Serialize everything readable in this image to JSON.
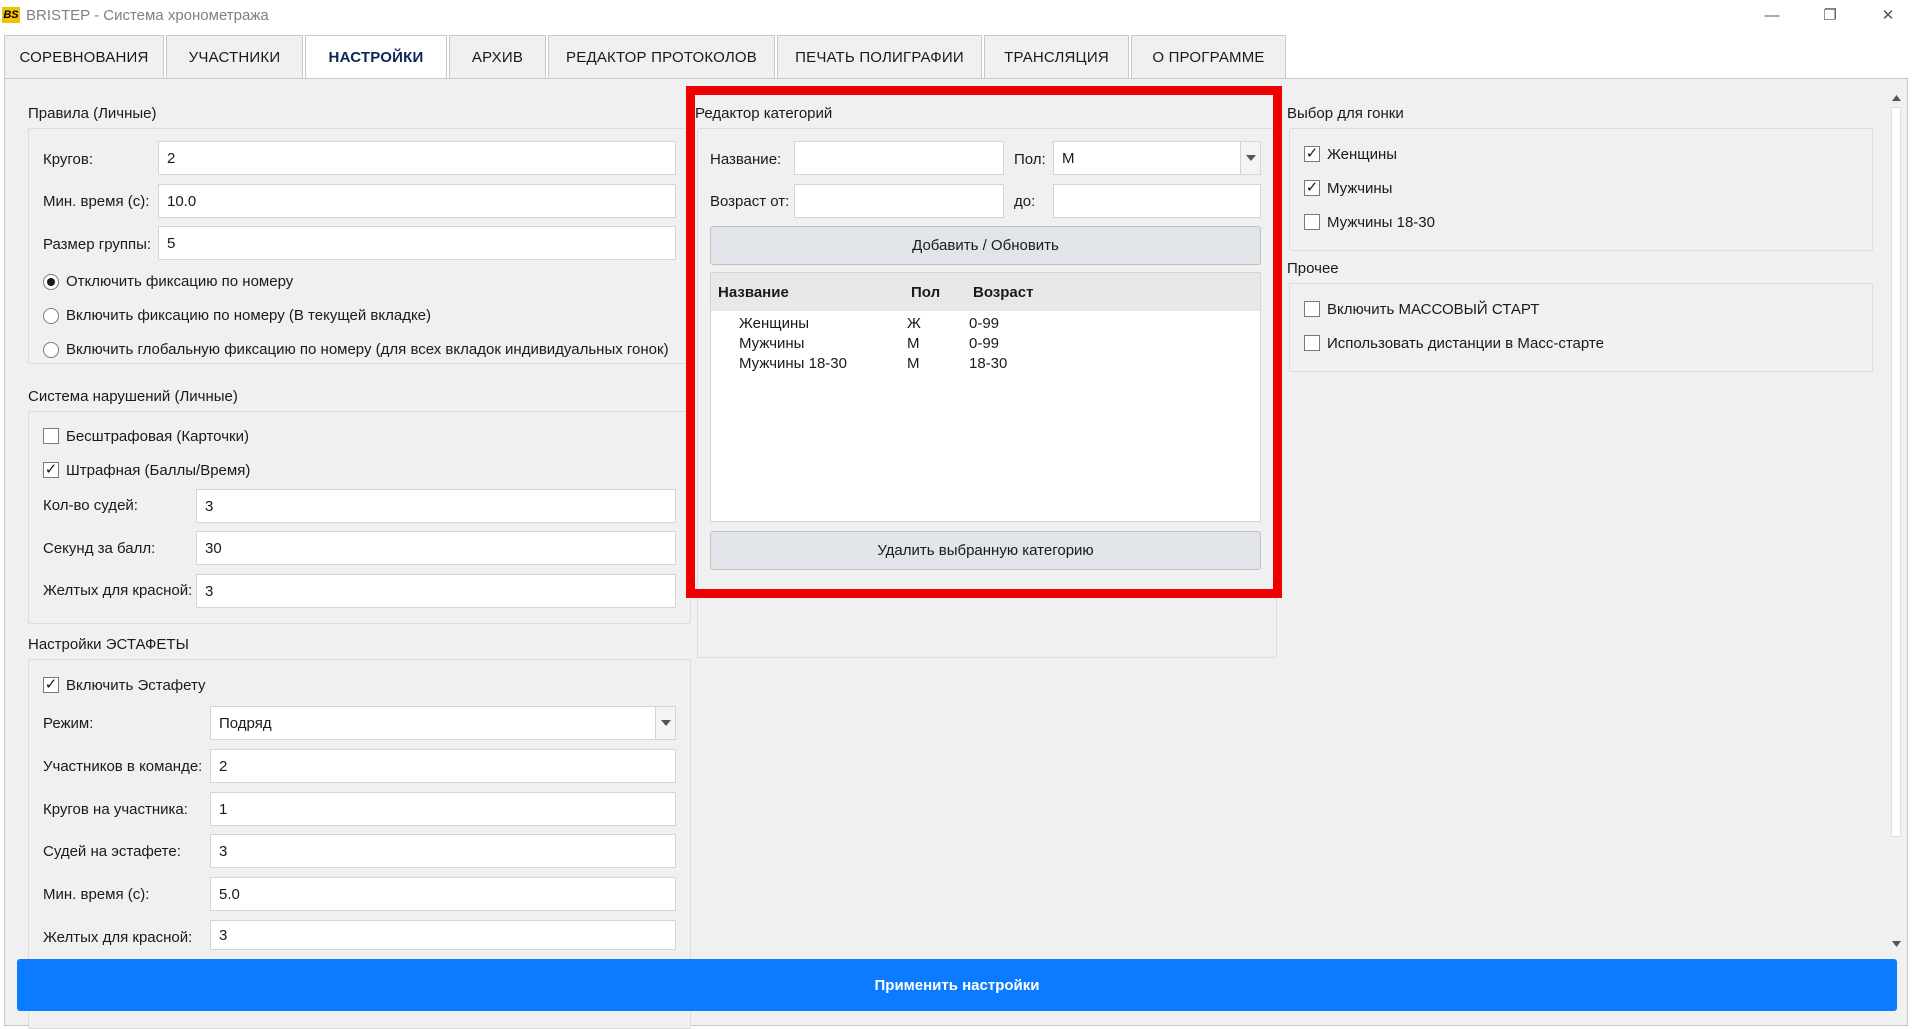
{
  "window": {
    "logo": "BS",
    "title": "BRISTEP - Система хронометража",
    "minimize": "—",
    "maximize": "❐",
    "close": "✕"
  },
  "tabs": [
    {
      "label": "СОРЕВНОВАНИЯ",
      "active": false
    },
    {
      "label": "УЧАСТНИКИ",
      "active": false
    },
    {
      "label": "НАСТРОЙКИ",
      "active": true
    },
    {
      "label": "АРХИВ",
      "active": false
    },
    {
      "label": "РЕДАКТОР ПРОТОКОЛОВ",
      "active": false
    },
    {
      "label": "ПЕЧАТЬ ПОЛИГРАФИИ",
      "active": false
    },
    {
      "label": "ТРАНСЛЯЦИЯ",
      "active": false
    },
    {
      "label": "О ПРОГРАММЕ",
      "active": false
    }
  ],
  "rules": {
    "title": "Правила (Личные)",
    "laps_label": "Кругов:",
    "laps_value": "2",
    "min_time_label": "Мин. время (с):",
    "min_time_value": "10.0",
    "group_size_label": "Размер группы:",
    "group_size_value": "5",
    "radio_disable": "Отключить фиксацию по номеру",
    "radio_tab": "Включить фиксацию по номеру (В текущей вкладке)",
    "radio_global": "Включить глобальную фиксацию по номеру (для всех вкладок индивидуальных гонок)",
    "selected_radio": "disable"
  },
  "violations": {
    "title": "Система нарушений (Личные)",
    "no_penalty_label": "Бесштрафовая (Карточки)",
    "no_penalty_checked": false,
    "penalty_label": "Штрафная (Баллы/Время)",
    "penalty_checked": true,
    "judges_label": "Кол-во судей:",
    "judges_value": "3",
    "sec_per_point_label": "Секунд за балл:",
    "sec_per_point_value": "30",
    "yellow_for_red_label": "Желтых для красной:",
    "yellow_for_red_value": "3"
  },
  "relay": {
    "title": "Настройки ЭСТАФЕТЫ",
    "enable_label": "Включить Эстафету",
    "enable_checked": true,
    "mode_label": "Режим:",
    "mode_value": "Подряд",
    "team_size_label": "Участников в команде:",
    "team_size_value": "2",
    "laps_per_label": "Кругов на участника:",
    "laps_per_value": "1",
    "judges_label": "Судей на эстафете:",
    "judges_value": "3",
    "min_time_label": "Мин. время (с):",
    "min_time_value": "5.0",
    "yellow_label": "Желтых для красной:",
    "yellow_value": "3"
  },
  "category_editor": {
    "title": "Редактор категорий",
    "name_label": "Название:",
    "name_value": "",
    "gender_label": "Пол:",
    "gender_value": "М",
    "age_from_label": "Возраст от:",
    "age_from_value": "",
    "age_to_label": "до:",
    "age_to_value": "",
    "add_button": "Добавить / Обновить",
    "delete_button": "Удалить выбранную категорию",
    "columns": [
      "Название",
      "Пол",
      "Возраст"
    ],
    "rows": [
      {
        "name": "Женщины",
        "gender": "Ж",
        "age": "0-99"
      },
      {
        "name": "Мужчины",
        "gender": "М",
        "age": "0-99"
      },
      {
        "name": "Мужчины 18-30",
        "gender": "М",
        "age": "18-30"
      }
    ]
  },
  "race_selection": {
    "title": "Выбор для гонки",
    "items": [
      {
        "label": "Женщины",
        "checked": true
      },
      {
        "label": "Мужчины",
        "checked": true
      },
      {
        "label": "Мужчины 18-30",
        "checked": false
      }
    ]
  },
  "other": {
    "title": "Прочее",
    "mass_start_label": "Включить МАССОВЫЙ СТАРТ",
    "mass_start_checked": false,
    "mass_dist_label": "Использовать дистанции в Масс-старте",
    "mass_dist_checked": false
  },
  "apply_button": "Применить настройки",
  "colors": {
    "accent": "#0b7cff",
    "highlight": "#ee0000",
    "active_tab_text": "#0d2456",
    "logo": "#f2c200"
  }
}
